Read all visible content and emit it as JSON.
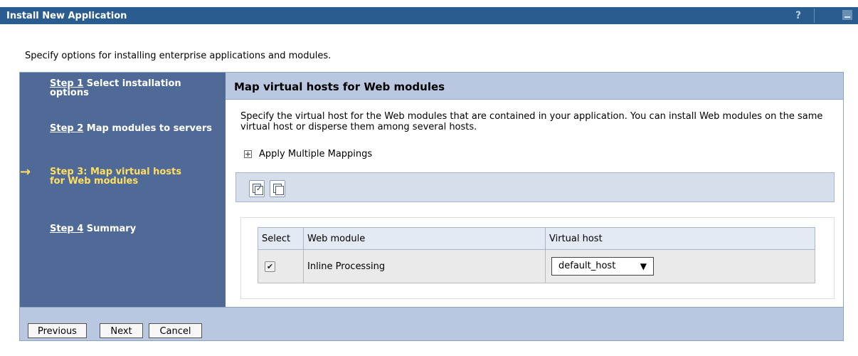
{
  "window": {
    "title": "Install New Application",
    "help_label": "?"
  },
  "intro": "Specify options for installing enterprise applications and modules.",
  "steps": [
    {
      "link": "Step 1",
      "rest": " Select installation options"
    },
    {
      "link": "Step 2",
      "rest": " Map modules to servers"
    },
    {
      "label": "Step 3: Map virtual hosts for Web modules",
      "current": true
    },
    {
      "link": "Step 4",
      "rest": " Summary"
    }
  ],
  "current_step_arrow": "→",
  "panel": {
    "title": "Map virtual hosts for Web modules",
    "description": "Specify the virtual host for the Web modules that are contained in your application. You can install Web modules on the same virtual host or disperse them among several hosts.",
    "apply_multiple": "Apply Multiple Mappings"
  },
  "table": {
    "headers": [
      "Select",
      "Web module",
      "Virtual host"
    ],
    "rows": [
      {
        "selected": true,
        "check_glyph": "✔",
        "web_module": "Inline Processing",
        "virtual_host": "default_host",
        "caret": "▼"
      }
    ]
  },
  "buttons": {
    "previous": "Previous",
    "next": "Next",
    "cancel": "Cancel"
  },
  "icons": {
    "select_all": "select-all-icon",
    "deselect_all": "deselect-all-icon"
  }
}
